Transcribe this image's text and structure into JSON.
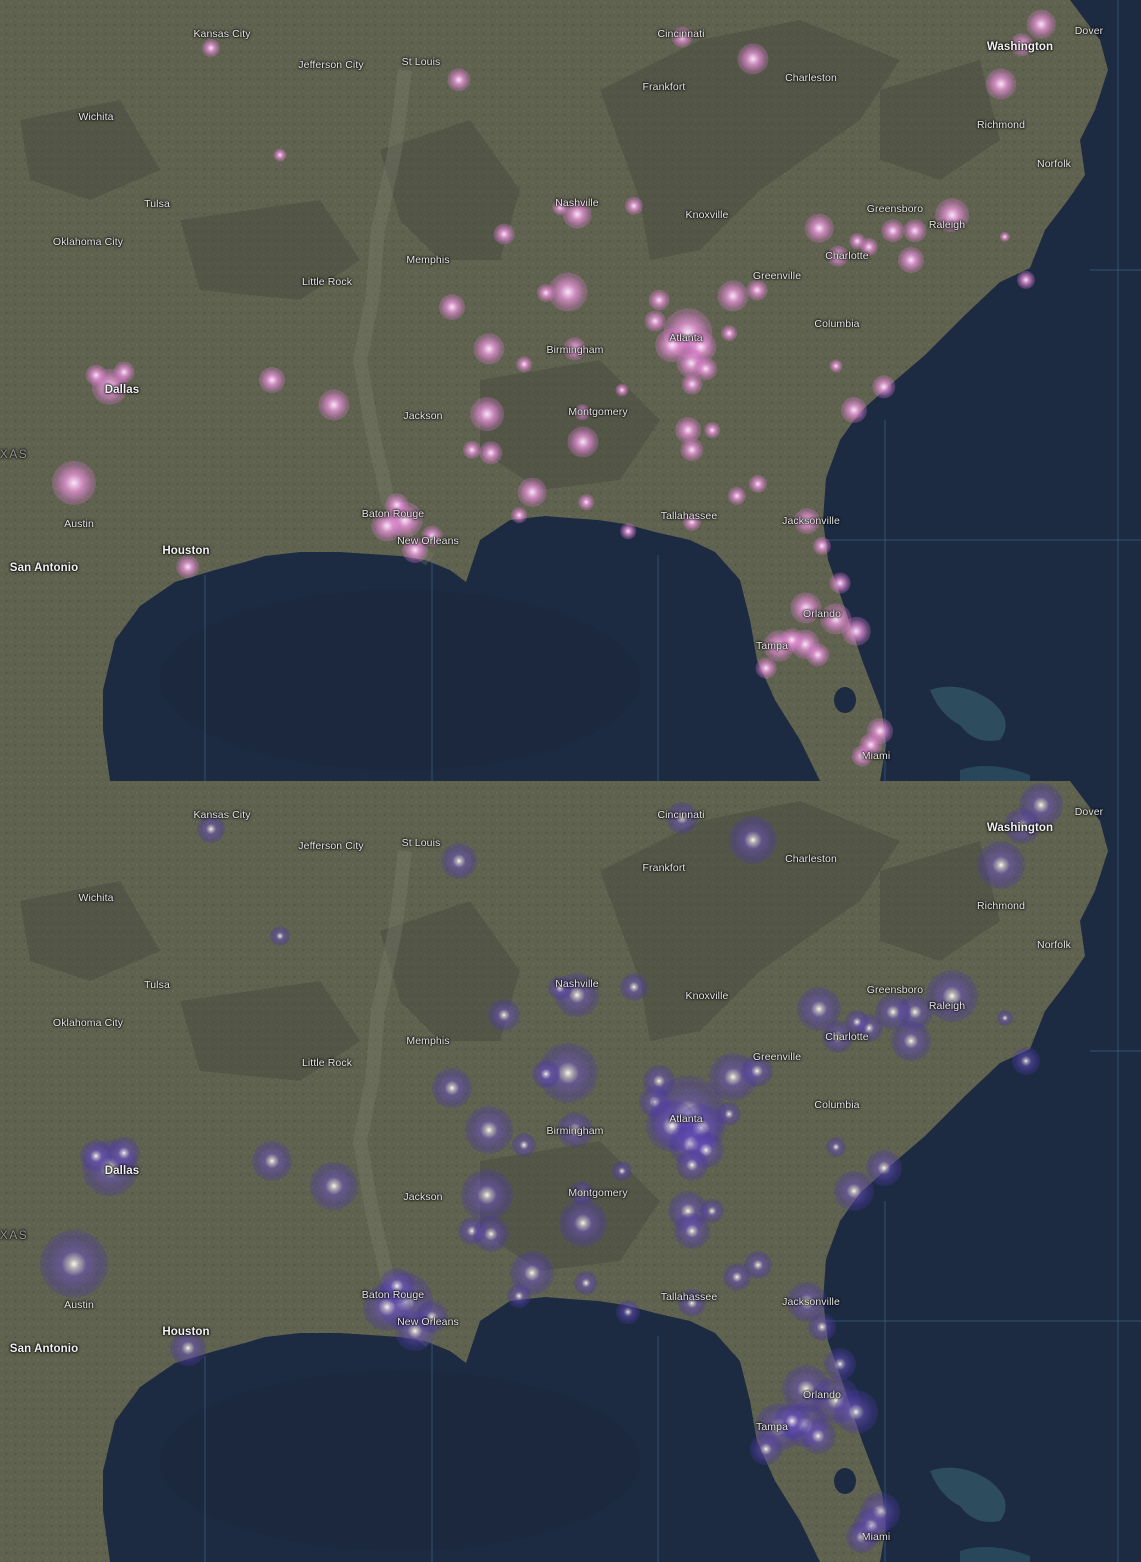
{
  "panels": [
    {
      "id": "top",
      "heat_style": "pink-glow"
    },
    {
      "id": "bottom",
      "heat_style": "purple-halo"
    }
  ],
  "colors": {
    "land": "#5f624f",
    "land_dark": "#454a3d",
    "water": "#1d2b42",
    "gulf_deep": "#19253a",
    "heat_top": "#f0a0e0",
    "heat_bottom": "#5a46b4",
    "graticule": "#3e6a88"
  },
  "labels": {
    "kansas_city": "Kansas City",
    "jefferson_city": "Jefferson City",
    "st_louis": "St Louis",
    "cincinnati": "Cincinnati",
    "washington": "Washington",
    "dover": "Dover",
    "frankfort": "Frankfort",
    "charleston": "Charleston",
    "wichita": "Wichita",
    "richmond": "Richmond",
    "norfolk": "Norfolk",
    "tulsa": "Tulsa",
    "nashville": "Nashville",
    "knoxville": "Knoxville",
    "greensboro": "Greensboro",
    "raleigh": "Raleigh",
    "oklahoma_city": "Oklahoma City",
    "memphis": "Memphis",
    "charlotte": "Charlotte",
    "greenville": "Greenville",
    "little_rock": "Little Rock",
    "columbia": "Columbia",
    "birmingham": "Birmingham",
    "atlanta": "Atlanta",
    "dallas": "Dallas",
    "jackson": "Jackson",
    "montgomery": "Montgomery",
    "texas": "XAS",
    "austin": "Austin",
    "baton_rouge": "Baton Rouge",
    "tallahassee": "Tallahassee",
    "jacksonville": "Jacksonville",
    "new_orleans": "New Orleans",
    "houston": "Houston",
    "san_antonio": "San Antonio",
    "orlando": "Orlando",
    "tampa": "Tampa",
    "miami": "Miami"
  }
}
